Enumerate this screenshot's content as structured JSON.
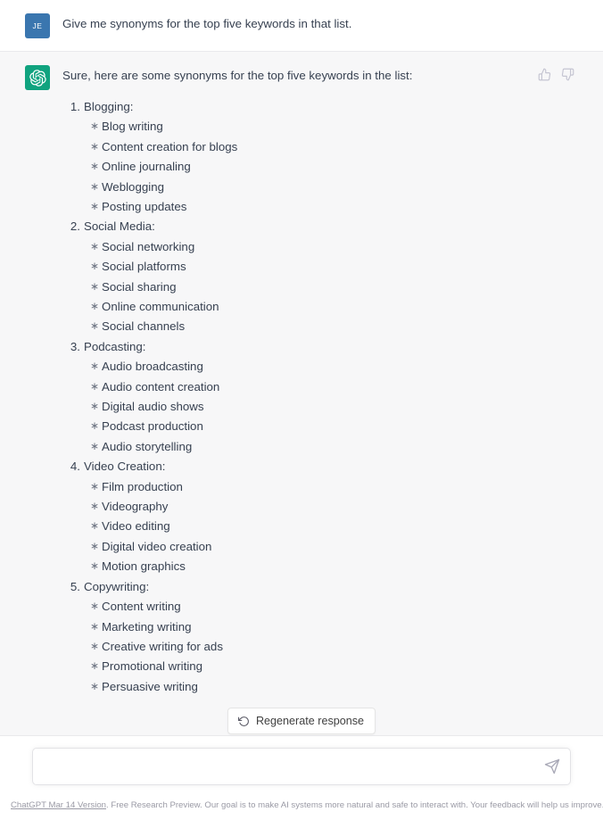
{
  "conversation": {
    "user_message": {
      "avatar_initials": "JE",
      "avatar_color": "#3a76af",
      "text": "Give me synonyms for the top five keywords in that list."
    },
    "assistant_message": {
      "avatar_color": "#10a37f",
      "avatar_icon": "openai-logo-icon",
      "intro": "Sure, here are some synonyms for the top five keywords in the list:",
      "feedback": {
        "thumbs_up_icon": "thumbs-up-icon",
        "thumbs_down_icon": "thumbs-down-icon"
      },
      "keyword_groups": [
        {
          "label": "Blogging:",
          "synonyms": [
            "Blog writing",
            "Content creation for blogs",
            "Online journaling",
            "Weblogging",
            "Posting updates"
          ]
        },
        {
          "label": "Social Media:",
          "synonyms": [
            "Social networking",
            "Social platforms",
            "Social sharing",
            "Online communication",
            "Social channels"
          ]
        },
        {
          "label": "Podcasting:",
          "synonyms": [
            "Audio broadcasting",
            "Audio content creation",
            "Digital audio shows",
            "Podcast production",
            "Audio storytelling"
          ]
        },
        {
          "label": "Video Creation:",
          "synonyms": [
            "Film production",
            "Videography",
            "Video editing",
            "Digital video creation",
            "Motion graphics"
          ]
        },
        {
          "label": "Copywriting:",
          "synonyms": [
            "Content writing",
            "Marketing writing",
            "Creative writing for ads",
            "Promotional writing",
            "Persuasive writing"
          ]
        }
      ]
    }
  },
  "regenerate": {
    "label": "Regenerate response",
    "icon": "refresh-icon"
  },
  "composer": {
    "value": "",
    "placeholder": "",
    "send_icon": "send-plane-icon"
  },
  "footer": {
    "link_text": "ChatGPT Mar 14 Version",
    "rest_text": ". Free Research Preview. Our goal is to make AI systems more natural and safe to interact with. Your feedback will help us improve."
  },
  "colors": {
    "user_row_bg": "#ffffff",
    "assistant_row_bg": "#f7f7f8",
    "text": "#374151",
    "brand_green": "#10a37f",
    "avatar_blue": "#3a76af",
    "icon_gray": "#c5c5d2"
  }
}
